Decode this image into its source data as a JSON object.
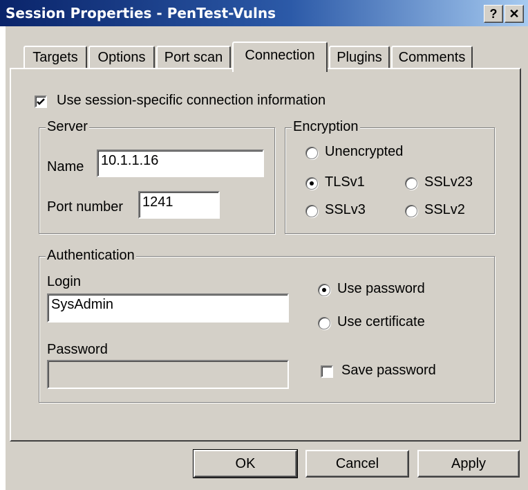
{
  "window": {
    "title": "Session Properties - PenTest-Vulns",
    "help_button": "?",
    "close_button": "✕"
  },
  "tabs": [
    "Targets",
    "Options",
    "Port scan",
    "Connection",
    "Plugins",
    "Comments"
  ],
  "active_tab": "Connection",
  "connection": {
    "use_session_specific": {
      "label": "Use session-specific connection information",
      "checked": true
    },
    "server": {
      "legend": "Server",
      "name_label": "Name",
      "name_value": "10.1.1.16",
      "port_label": "Port number",
      "port_value": "1241"
    },
    "encryption": {
      "legend": "Encryption",
      "options": [
        {
          "label": "Unencrypted",
          "selected": false
        },
        {
          "label": "TLSv1",
          "selected": true
        },
        {
          "label": "SSLv23",
          "selected": false
        },
        {
          "label": "SSLv3",
          "selected": false
        },
        {
          "label": "SSLv2",
          "selected": false
        }
      ]
    },
    "authentication": {
      "legend": "Authentication",
      "login_label": "Login",
      "login_value": "SysAdmin",
      "password_label": "Password",
      "password_value": "",
      "use_password": {
        "label": "Use password",
        "selected": true
      },
      "use_certificate": {
        "label": "Use certificate",
        "selected": false
      },
      "save_password": {
        "label": "Save password",
        "checked": false
      }
    }
  },
  "buttons": {
    "ok": "OK",
    "cancel": "Cancel",
    "apply": "Apply"
  },
  "colors": {
    "titlebar_start": "#0a246a",
    "titlebar_end": "#a6caf0",
    "face": "#d4d0c8"
  }
}
